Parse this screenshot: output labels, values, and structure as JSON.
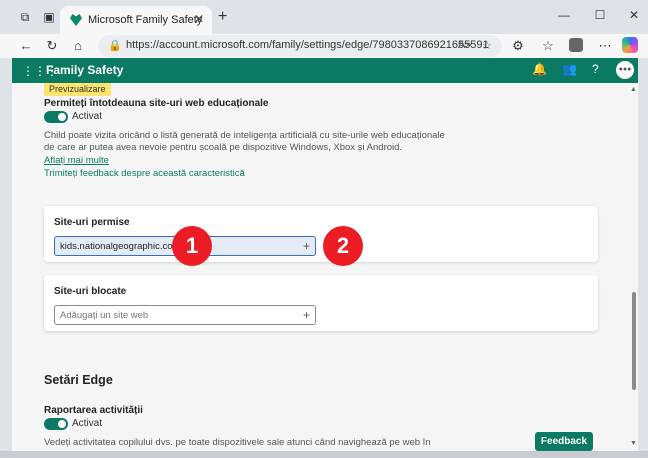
{
  "browser": {
    "tab_title": "Microsoft Family Safety",
    "tab_close": "✕",
    "new_tab": "+",
    "url": "https://account.microsoft.com/family/settings/edge/7980337086921655591",
    "profile_initials": "",
    "window_controls": [
      "—",
      "☐",
      "✕"
    ]
  },
  "header": {
    "app_title": "Family Safety",
    "avatar_text": "●●●"
  },
  "main": {
    "preview_badge": "Previzualizare",
    "edu_sites": {
      "title": "Permiteți întotdeauna site-uri web educaționale",
      "toggle_label": "Activat",
      "toggle_on": true,
      "description_line1": "Child poate vizita oricând o listă generată de inteligența artificială cu site-urile web educaționale",
      "description_line2": "de care ar putea avea nevoie pentru școală pe dispozitive Windows, Xbox și Android.",
      "learn_more": "Aflați mai multe",
      "feedback_link": "Trimiteți feedback despre această caracteristică"
    },
    "allowed_sites": {
      "title": "Site-uri permise",
      "input_value": "kids.nationalgeographic.com",
      "add_icon": "+"
    },
    "blocked_sites": {
      "title": "Site-uri blocate",
      "input_placeholder": "Adăugați un site web",
      "add_icon": "+"
    },
    "edge_settings": {
      "title": "Setări Edge",
      "activity_title": "Raportarea activității",
      "toggle_label": "Activat",
      "toggle_on": true,
      "description": "Vedeți activitatea copilului dvs. pe toate dispozitivele sale atunci când navighează pe web în"
    },
    "feedback_button": "Feedback"
  },
  "callouts": [
    "1",
    "2"
  ],
  "colors": {
    "brand_green": "#0b7a62",
    "callout_red": "#ec1c24",
    "preview_yellow": "#fbe46f"
  }
}
